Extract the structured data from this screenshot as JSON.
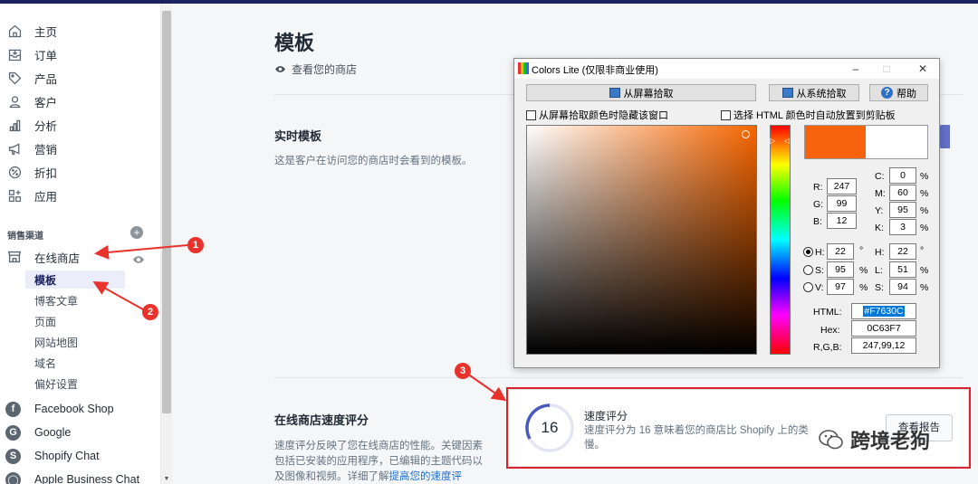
{
  "sidebar": {
    "items": [
      {
        "label": "主页",
        "icon": "home-icon"
      },
      {
        "label": "订单",
        "icon": "orders-icon"
      },
      {
        "label": "产品",
        "icon": "tag-icon"
      },
      {
        "label": "客户",
        "icon": "user-icon"
      },
      {
        "label": "分析",
        "icon": "bar-chart-icon"
      },
      {
        "label": "营销",
        "icon": "megaphone-icon"
      },
      {
        "label": "折扣",
        "icon": "discount-icon"
      },
      {
        "label": "应用",
        "icon": "apps-icon"
      }
    ],
    "sales_channels_title": "销售渠道",
    "online_store": "在线商店",
    "sub_items": [
      "模板",
      "博客文章",
      "页面",
      "网站地图",
      "域名",
      "偏好设置"
    ],
    "channels": [
      {
        "label": "Facebook Shop",
        "glyph": "f"
      },
      {
        "label": "Google",
        "glyph": "G"
      },
      {
        "label": "Shopify Chat",
        "glyph": "S"
      },
      {
        "label": "Apple Business Chat",
        "glyph": "◯"
      }
    ]
  },
  "main": {
    "title": "模板",
    "view_store": "查看您的商店",
    "live_theme_title": "实时模板",
    "live_theme_desc": "这是客户在访问您的商店时会看到的模板。",
    "speed_title": "在线商店速度评分",
    "speed_desc": "速度评分反映了您在线商店的性能。关键因素包括已安装的应用程序，已编辑的主题代码以及图像和视频。详细了解",
    "speed_link": "提高您的速度评"
  },
  "speed_card": {
    "score": "16",
    "title": "速度评分",
    "desc": "速度评分为 16 意味着您的商店比 Shopify 上的类",
    "desc2": "慢。",
    "button": "查看报告"
  },
  "annotations": [
    "1",
    "2",
    "3"
  ],
  "watermark": "跨境老狗",
  "colors_window": {
    "title": "Colors Lite (仅限非商业使用)",
    "btn_screen": "从屏幕拾取",
    "btn_system": "从系统拾取",
    "btn_help": "帮助",
    "chk_hide": "从屏幕拾取颜色时隐藏该窗口",
    "chk_clip": "选择 HTML 颜色时自动放置到剪贴板",
    "rgb": {
      "R": "247",
      "G": "99",
      "B": "12"
    },
    "cmyk": {
      "C": "0",
      "M": "60",
      "Y": "95",
      "K": "3"
    },
    "hsv": {
      "H": "22",
      "S": "95",
      "V": "97"
    },
    "hsl": {
      "H": "22",
      "L": "51",
      "S": "94"
    },
    "html_label": "HTML:",
    "html_value": "#F7630C",
    "hex_label": "Hex:",
    "hex_value": "0C63F7",
    "rgb_label": "R,G,B:",
    "rgb_value": "247,99,12",
    "color_new": "#f7630c"
  }
}
